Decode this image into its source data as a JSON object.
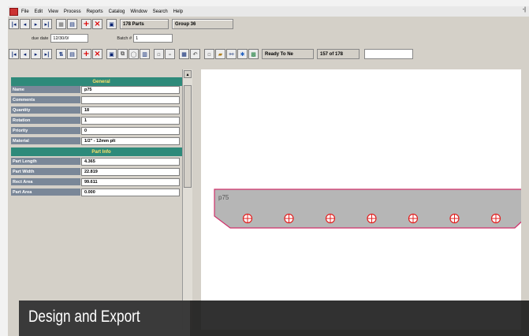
{
  "menubar": {
    "items": [
      "File",
      "Edit",
      "View",
      "Process",
      "Reports",
      "Catalog",
      "Window",
      "Search",
      "Help"
    ],
    "close_glyph": "-|"
  },
  "toolbar1": {
    "part_count": "178 Parts",
    "group": "Group 36"
  },
  "toolbar2": {
    "due_date_label": "due date",
    "due_date_value": "12/30/0/",
    "batch_label": "Batch #",
    "batch_value": "1"
  },
  "toolbar3": {
    "status": "Ready To Ne",
    "record": "157 of 178"
  },
  "properties": {
    "general_header": "General",
    "general": [
      {
        "key": "Name",
        "value": "p75"
      },
      {
        "key": "Comments",
        "value": ""
      },
      {
        "key": "Quantity",
        "value": "18"
      },
      {
        "key": "Rotation",
        "value": "1"
      },
      {
        "key": "Priority",
        "value": "0"
      },
      {
        "key": "Material",
        "value": "1/2\" - 12mm plt"
      }
    ],
    "part_info_header": "Part Info",
    "part_info": [
      {
        "key": "Part Length",
        "value": "4.365"
      },
      {
        "key": "Part Width",
        "value": "22.819"
      },
      {
        "key": "Rect Area",
        "value": "99.611"
      },
      {
        "key": "Part Area",
        "value": "0.000"
      }
    ]
  },
  "canvas": {
    "part_label": "p75",
    "hole_count": 7
  },
  "caption": {
    "text": "Design and Export"
  },
  "colors": {
    "header_teal": "#2e8a7a",
    "header_text": "#ffe36a",
    "key_cell": "#7a8798",
    "part_fill": "#b6b6b6",
    "part_outline": "#d0306a",
    "hole": "#e02020"
  }
}
